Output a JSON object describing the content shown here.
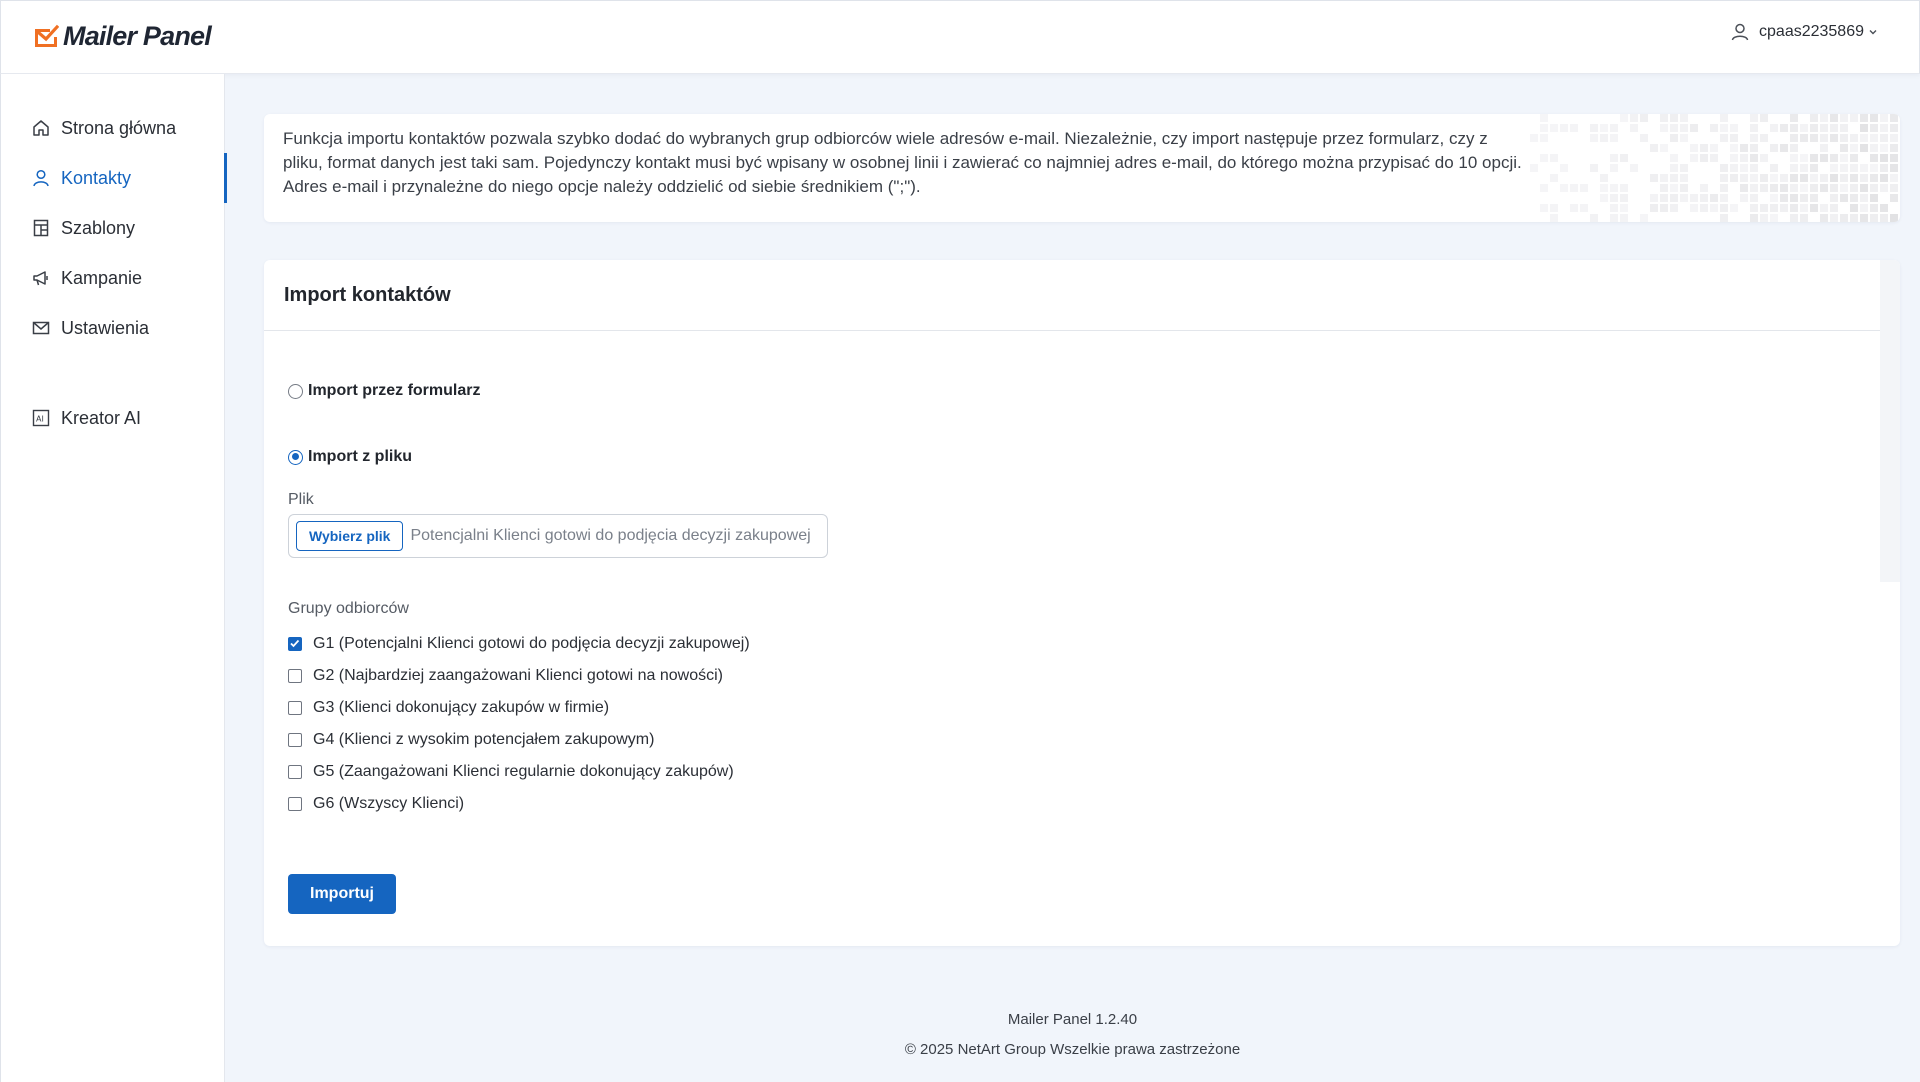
{
  "app": {
    "name": "Mailer Panel",
    "user": "cpaas2235869"
  },
  "colors": {
    "accent": "#1565c0",
    "logo": "#f07023"
  },
  "sidebar": {
    "items": [
      {
        "label": "Strona główna",
        "icon": "home-icon"
      },
      {
        "label": "Kontakty",
        "icon": "user-icon",
        "active": true
      },
      {
        "label": "Szablony",
        "icon": "template-icon"
      },
      {
        "label": "Kampanie",
        "icon": "megaphone-icon"
      },
      {
        "label": "Ustawienia",
        "icon": "envelope-icon"
      },
      {
        "label": "Kreator AI",
        "icon": "ai-icon"
      }
    ]
  },
  "info": {
    "text": "Funkcja importu kontaktów pozwala szybko dodać do wybranych grup odbiorców wiele adresów e-mail. Niezależnie, czy import następuje przez formularz, czy z pliku, format danych jest taki sam. Pojedynczy kontakt musi być wpisany w osobnej linii i zawierać co najmniej adres e-mail, do którego można przypisać do 10 opcji. Adres e-mail i przynależne do niego opcje należy oddzielić od siebie średnikiem (\";\")."
  },
  "import": {
    "title": "Import kontaktów",
    "option_form": "Import przez formularz",
    "option_file": "Import z pliku",
    "selected_option": "file",
    "file_label": "Plik",
    "file_button": "Wybierz plik",
    "file_name": "Potencjalni Klienci gotowi do podjęcia decyzji zakupowej",
    "groups_label": "Grupy odbiorców",
    "groups": [
      {
        "label": "G1 (Potencjalni Klienci gotowi do podjęcia decyzji zakupowej)",
        "checked": true
      },
      {
        "label": "G2 (Najbardziej zaangażowani Klienci gotowi na nowości)",
        "checked": false
      },
      {
        "label": "G3 (Klienci dokonujący zakupów w firmie)",
        "checked": false
      },
      {
        "label": "G4 (Klienci z wysokim potencjałem zakupowym)",
        "checked": false
      },
      {
        "label": "G5 (Zaangażowani Klienci regularnie dokonujący zakupów)",
        "checked": false
      },
      {
        "label": "G6 (Wszyscy Klienci)",
        "checked": false
      }
    ],
    "submit": "Importuj"
  },
  "footer": {
    "version": "Mailer Panel 1.2.40",
    "copyright": "© 2025 NetArt Group Wszelkie prawa zastrzeżone"
  }
}
